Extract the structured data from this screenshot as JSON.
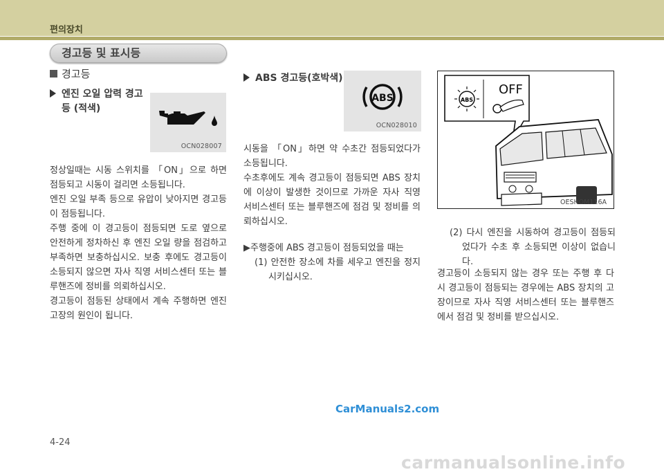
{
  "header": {
    "title": "편의장치"
  },
  "section_title": "경고등 및 표시등",
  "left": {
    "heading": "경고등",
    "oil_warning": {
      "title_line1": "엔진 오일 압력 경고",
      "title_line2": "등 (적색)",
      "icon": "oil-can-icon",
      "icon_code": "OCN028007"
    },
    "paragraphs": [
      "정상일때는 시동 스위치를 「ON」으로 하면 점등되고 시동이 걸리면 소등됩니다.",
      "엔진 오일 부족 등으로 유압이 낮아지면 경고등이 점등됩니다.",
      "주행 중에 이 경고등이 점등되면 도로 옆으로 안전하게 정차하신 후 엔진 오일 량을 점검하고 부족하면 보충하십시오. 보충 후에도 경고등이 소등되지 않으면 자사 직영 서비스센터 또는 블루핸즈에 정비를 의뢰하십시오.",
      "경고등이 점등된 상태에서 계속 주행하면 엔진 고장의 원인이 됩니다."
    ]
  },
  "middle": {
    "title": "ABS 경고등(호박색)",
    "icon": "abs-warning-icon",
    "icon_label": "ABS",
    "icon_code": "OCN028010",
    "paragraphs": [
      "시동을 「ON」하면 약 수초간 점등되었다가 소등됩니다.",
      "수초후에도 계속 경고등이 점등되면 ABS 장치에 이상이 발생한 것이므로 가까운 자사 직영 서비스센터 또는 블루핸즈에 점검 및 정비를 의뢰하십시오."
    ],
    "subheading": "▶주행중에 ABS 경고등이 점등되었을 때는",
    "step1": "(1) 안전한 장소에 차를 세우고 엔진을 정지시키십시오."
  },
  "right": {
    "image": {
      "code": "OESHOM116A",
      "bubble_label": "OFF",
      "icon_label": "ABS"
    },
    "step2": "(2) 다시 엔진을 시동하여 경고등이 점등되었다가 수초 후 소등되면 이상이 없습니다.",
    "paragraph": "경고등이 소등되지 않는 경우 또는 주행 후 다시 경고등이 점등되는 경우에는 ABS 장치의 고장이므로 자사 직영 서비스센터 또는 블루핸즈에서 점검 및 정비를 받으십시오."
  },
  "footer": {
    "page_number": "4-24"
  },
  "watermarks": {
    "top": "CarManuals2.com",
    "bottom": "carmanualsonline.info"
  },
  "colors": {
    "header": "#d4d0a0",
    "header_rule": "#b1ab69",
    "watermark_blue": "#2f8fd6"
  }
}
